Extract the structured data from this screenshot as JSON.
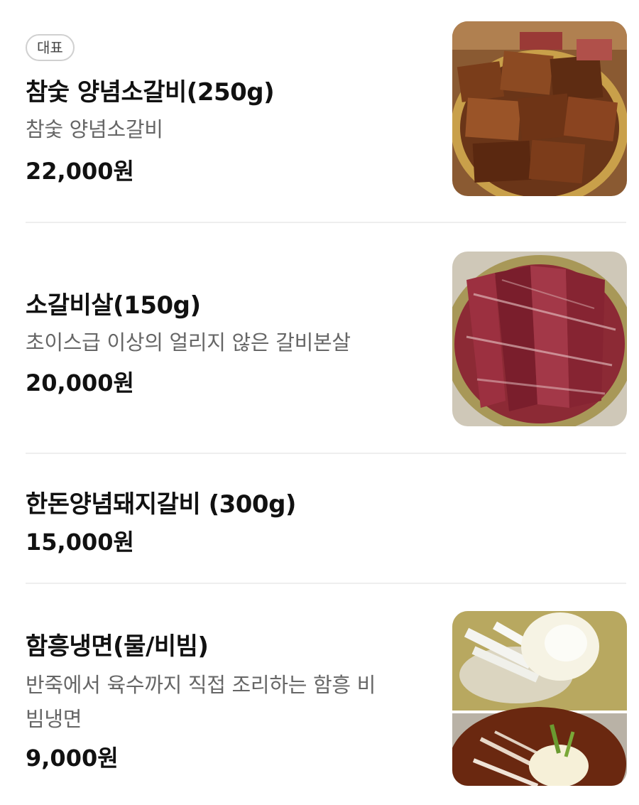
{
  "menu": {
    "items": [
      {
        "badge": "대표",
        "name": "참숯 양념소갈비(250g)",
        "description": "참숯 양념소갈비",
        "price": "22,000원",
        "image": "marinated-beef-short-ribs-photo"
      },
      {
        "name": "소갈비살(150g)",
        "description": "초이스급 이상의 얼리지 않은 갈비본살",
        "price": "20,000원",
        "image": "raw-beef-rib-meat-photo"
      },
      {
        "name": "한돈양념돼지갈비 (300g)",
        "price": "15,000원"
      },
      {
        "name": "함흥냉면(물/비빔)",
        "description_line1": "반죽에서 육수까지 직접 조리하는 함흥 비",
        "description_line2": "빔냉면",
        "price": "9,000원",
        "image": "naengmyeon-cold-noodles-photo"
      }
    ]
  }
}
